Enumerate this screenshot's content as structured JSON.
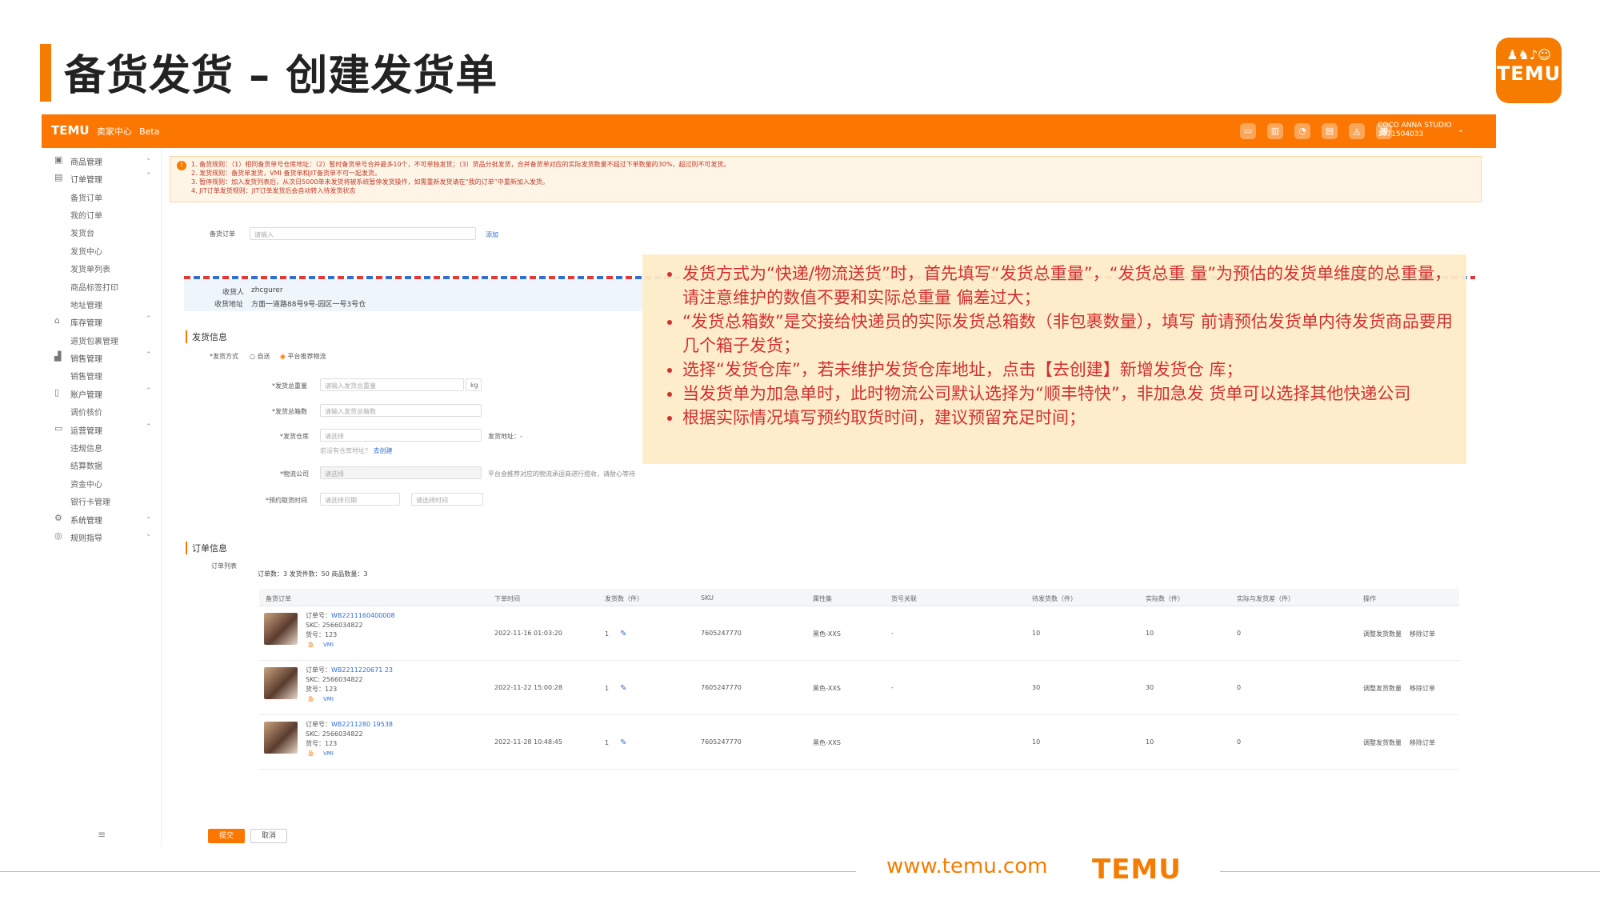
{
  "slide": {
    "title": "备货发货 – 创建发货单",
    "logo_word": "TEMU",
    "footer_url": "www.temu.com",
    "footer_logo": "TEMU"
  },
  "topbar": {
    "brand": "TEMU",
    "brand_sub": "卖家中心",
    "beta": "Beta",
    "store_name": "COCO ANNA STUDIO",
    "store_id": "1071504033",
    "icons": [
      "monitor-icon",
      "book-icon",
      "chat-icon",
      "doc-icon",
      "bell-icon"
    ]
  },
  "sidebar": {
    "items": [
      {
        "label": "商品管理",
        "group": true
      },
      {
        "label": "订单管理",
        "group": true
      },
      {
        "label": "备货订单",
        "group": false
      },
      {
        "label": "我的订单",
        "group": false
      },
      {
        "label": "发货台",
        "group": false
      },
      {
        "label": "发货中心",
        "group": false
      },
      {
        "label": "发货单列表",
        "group": false
      },
      {
        "label": "商品标签打印",
        "group": false
      },
      {
        "label": "地址管理",
        "group": false
      },
      {
        "label": "库存管理",
        "group": true
      },
      {
        "label": "退货包裹管理",
        "group": false
      },
      {
        "label": "销售管理",
        "group": true
      },
      {
        "label": "销售管理",
        "group": false
      },
      {
        "label": "账户管理",
        "group": true
      },
      {
        "label": "调价核价",
        "group": false
      },
      {
        "label": "运营管理",
        "group": true
      },
      {
        "label": "违规信息",
        "group": false
      },
      {
        "label": "结算数据",
        "group": false
      },
      {
        "label": "资金中心",
        "group": false
      },
      {
        "label": "银行卡管理",
        "group": false
      },
      {
        "label": "系统管理",
        "group": true
      },
      {
        "label": "规则指导",
        "group": true
      }
    ],
    "footer": "≡"
  },
  "notice": {
    "lines": [
      "1. 备货规则：（1）相同备货单号仓库地址：（2）暂时备货单号合并最多10个，不可单独发货；（3）货品分批发货，合并备货单对应的实际发货数量不超过下单数量的30%，超过则不可发货。",
      "2. 发货规则：备货单发货，VMI 备货单和JIT备货单不可一起发货。",
      "3. 暂停规则：加入发货列表后，从次日5000单未发货将被系统暂停发货操作，如需重新发货请在“我的订单”中重新加入发货。",
      "4. JIT订单发货规则：JIT订单发货后会自动转入待发货状态"
    ]
  },
  "form": {
    "order_label": "备货订单",
    "order_placeholder": "请输入",
    "add_link": "添加",
    "receiver_label": "收货人",
    "receiver_value": "zhcgurer",
    "address_label": "收货地址",
    "address_value": "方面一道路88号9号-园区一号3号仓",
    "section_ship": "发货信息",
    "method_label": "*发货方式",
    "method_opt1": "自送",
    "method_opt2": "平台推荐物流",
    "weight_label": "*发货总重量",
    "weight_placeholder": "请输入发货总重量",
    "weight_unit": "kg",
    "boxes_label": "*发货总箱数",
    "boxes_placeholder": "请输入发货总箱数",
    "warehouse_label": "*发货仓库",
    "warehouse_placeholder": "请选择",
    "warehouse_hint": "若没有仓库地址？",
    "warehouse_link": "去创建",
    "warehouse_addr": "发货地址：-",
    "logistics_label": "*物流公司",
    "logistics_placeholder": "请选择",
    "logistics_hint": "平台会推荐对应的物流承运商进行揽收，请耐心等待",
    "pickup_label": "*预约取货时间",
    "pickup_date": "请选择日期",
    "pickup_time": "请选择时间",
    "section_order": "订单信息",
    "order_list_label": "订单列表",
    "summary": "订单数：3   发货件数：50   商品数量：3"
  },
  "callout": {
    "bullets": [
      "发货方式为“快递/物流送货”时，首先填写“发货总重量”，“发货总重 量”为预估的发货单维度的总重量，请注意维护的数值不要和实际总重量 偏差过大；",
      "“发货总箱数”是交接给快递员的实际发货总箱数（非包裹数量），填写 前请预估发货单内待发货商品要用几个箱子发货；",
      "选择“发货仓库”，若未维护发货仓库地址，点击【去创建】新增发货仓 库；",
      "当发货单为加急单时，此时物流公司默认选择为“顺丰特快”，非加急发 货单可以选择其他快递公司",
      "根据实际情况填写预约取货时间，建议预留充足时间；"
    ]
  },
  "table": {
    "headers": [
      "备货订单",
      "下单时间",
      "发货数（件）",
      "SKU",
      "属性集",
      "货号关联",
      "待发货数（件）",
      "实际数（件）",
      "实际与发货差（件）",
      "操作"
    ],
    "rows": [
      {
        "order_no_label": "订单号：",
        "order_no": "WB2211160400008",
        "skc": "SKC: 2566034822",
        "item_no": "货号：123",
        "tag1": "急",
        "tag2": "VMI",
        "time": "2022-11-16 01:03:20",
        "qty": "1",
        "sku": "7605247770",
        "attr": "黑色-XXS",
        "rel": "-",
        "pending": "10",
        "actual": "10",
        "diff": "0",
        "op1": "调整发货数量",
        "op2": "移除订单"
      },
      {
        "order_no_label": "订单号：",
        "order_no": "WB2211220671 23",
        "skc": "SKC: 2566034822",
        "item_no": "货号：123",
        "tag1": "急",
        "tag2": "VMI",
        "time": "2022-11-22 15:00:28",
        "qty": "1",
        "sku": "7605247770",
        "attr": "黑色-XXS",
        "rel": "-",
        "pending": "30",
        "actual": "30",
        "diff": "0",
        "op1": "调整发货数量",
        "op2": "移除订单"
      },
      {
        "order_no_label": "订单号：",
        "order_no": "WB2211280 19538",
        "skc": "SKC: 2566034822",
        "item_no": "货号：123",
        "tag1": "急",
        "tag2": "VMI",
        "time": "2022-11-28 10:48:45",
        "qty": "1",
        "sku": "7605247770",
        "attr": "黑色-XXS",
        "rel": "",
        "pending": "10",
        "actual": "10",
        "diff": "0",
        "op1": "调整发货数量",
        "op2": "移除订单"
      }
    ]
  },
  "actions": {
    "submit": "提交",
    "cancel": "取消"
  }
}
